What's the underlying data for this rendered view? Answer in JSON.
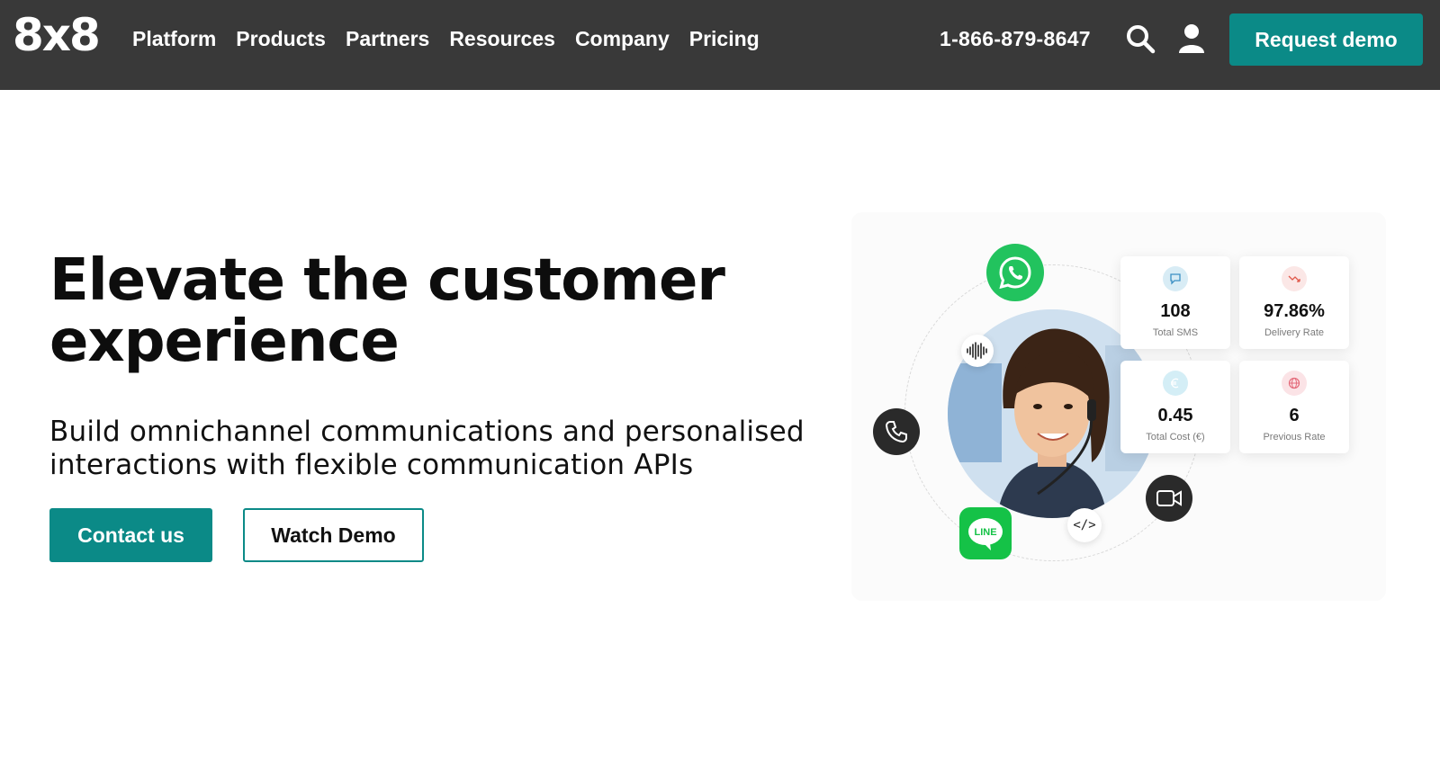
{
  "header": {
    "logo": "8x8",
    "nav": [
      "Platform",
      "Products",
      "Partners",
      "Resources",
      "Company",
      "Pricing"
    ],
    "phone": "1-866-879-8647",
    "cta": "Request demo"
  },
  "hero": {
    "title_line1": "Elevate the customer",
    "title_line2": "experience",
    "subtitle_line1": "Build omnichannel communications and personalised",
    "subtitle_line2": "interactions with flexible communication APIs",
    "contact_label": "Contact us",
    "watch_label": "Watch Demo"
  },
  "illustration": {
    "line_badge": "LINE",
    "code_badge": "</>",
    "stats": [
      {
        "value": "108",
        "label": "Total SMS",
        "icon": "chat-icon",
        "color": "#d8ecf5"
      },
      {
        "value": "97.86%",
        "label": "Delivery Rate",
        "icon": "trend-down-icon",
        "color": "#fbe7e6"
      },
      {
        "value": "0.45",
        "label": "Total Cost (€)",
        "icon": "euro-icon",
        "color": "#d4eef6"
      },
      {
        "value": "6",
        "label": "Previous Rate",
        "icon": "globe-icon",
        "color": "#fbe3e6"
      }
    ]
  },
  "colors": {
    "accent": "#0b8a87",
    "header_bg": "#393939",
    "whatsapp": "#22c35e",
    "line": "#15c247"
  }
}
